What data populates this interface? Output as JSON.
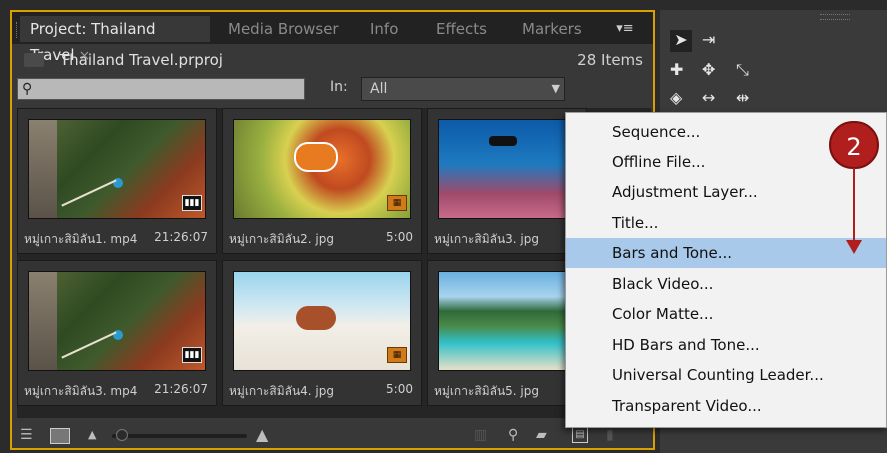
{
  "tabs": [
    {
      "label": "Project: Thailand Travel",
      "close": "×"
    },
    {
      "label": "Media Browser"
    },
    {
      "label": "Info"
    },
    {
      "label": "Effects"
    },
    {
      "label": "Markers"
    }
  ],
  "tab_menu_icon": "▾≡",
  "project": {
    "file": "Thailand Travel.prproj",
    "items": "28 Items"
  },
  "search": {
    "placeholder": "",
    "icon": "search-icon"
  },
  "filter": {
    "label": "In:",
    "value": "All"
  },
  "tiles": [
    {
      "name": "หมู่เกาะสิมิลัน1. mp4",
      "duration": "21:26:07",
      "badge": "video"
    },
    {
      "name": "หมู่เกาะสิมิลัน2. jpg",
      "duration": "5:00",
      "badge": "image"
    },
    {
      "name": "หมู่เกาะสิมิลัน3. jpg",
      "duration": "",
      "badge": ""
    },
    {
      "name": "หมู่เกาะสิมิลัน3. mp4",
      "duration": "21:26:07",
      "badge": "video"
    },
    {
      "name": "หมู่เกาะสิมิลัน4. jpg",
      "duration": "5:00",
      "badge": "image"
    },
    {
      "name": "หมู่เกาะสิมิลัน5. jpg",
      "duration": "",
      "badge": ""
    }
  ],
  "menu": {
    "items": [
      "Sequence...",
      "Offline File...",
      "Adjustment Layer...",
      "Title...",
      "Bars and Tone...",
      "Black Video...",
      "Color Matte...",
      "HD Bars and Tone...",
      "Universal Counting Leader...",
      "Transparent Video..."
    ],
    "highlighted_index": 4
  },
  "annotation": {
    "step": "2",
    "color": "#b01e1e"
  },
  "colors": {
    "panel_border": "#d9a000",
    "menu_highlight": "#a8c9ea"
  }
}
